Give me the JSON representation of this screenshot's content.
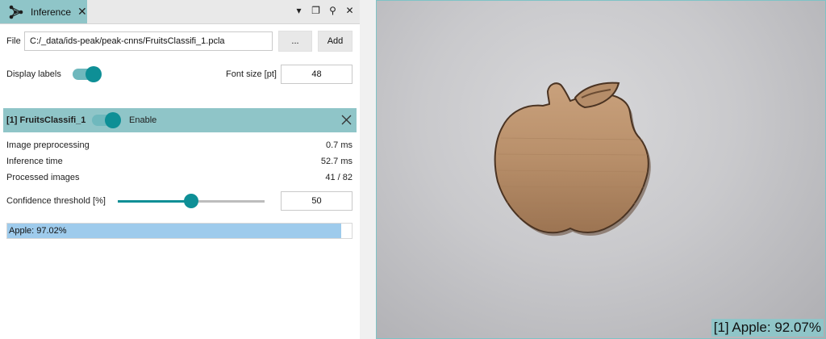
{
  "tab": {
    "title": "Inference"
  },
  "file": {
    "label": "File",
    "path": "C:/_data/ids-peak/peak-cnns/FruitsClassifi_1.pcla",
    "browse_label": "...",
    "add_label": "Add"
  },
  "display": {
    "label": "Display labels",
    "enabled": true,
    "font_size_label": "Font size [pt]",
    "font_size": "48"
  },
  "model": {
    "title": "[1] FruitsClassifi_1",
    "enable_label": "Enable",
    "stats": [
      {
        "label": "Image preprocessing",
        "value": "0.7 ms"
      },
      {
        "label": "Inference time",
        "value": "52.7 ms"
      },
      {
        "label": "Processed images",
        "value": "41 / 82"
      }
    ],
    "confidence_label": "Confidence threshold [%]",
    "confidence_value": "50",
    "confidence_fraction": 0.5,
    "result_text": "Apple: 97.02%",
    "result_fraction": 0.9702
  },
  "viewer": {
    "overlay_text": "[1] Apple: 92.07%"
  },
  "colors": {
    "accent": "#0e8f96",
    "tab": "#8fc5c8",
    "result_bar": "#9ecbec"
  }
}
